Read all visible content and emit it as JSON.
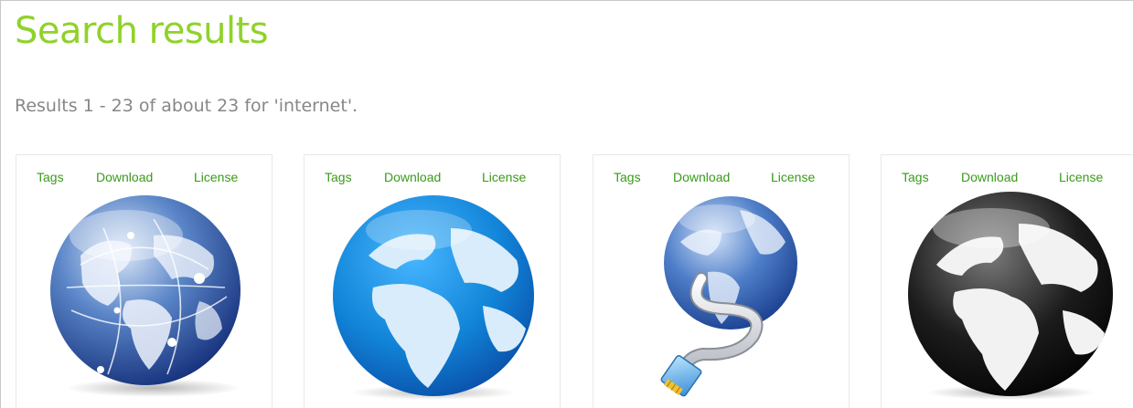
{
  "heading": "Search results",
  "summary": "Results 1 - 23 of about 23 for 'internet'.",
  "colors": {
    "heading": "#8fd22a",
    "summary": "#878787",
    "link": "#3a9a1a"
  },
  "results": [
    {
      "icon": "globe-network-icon",
      "tags_label": "Tags",
      "download_label": "Download",
      "license_label": "License"
    },
    {
      "icon": "globe-blue-icon",
      "tags_label": "Tags",
      "download_label": "Download",
      "license_label": "License"
    },
    {
      "icon": "globe-network-cable-icon",
      "tags_label": "Tags",
      "download_label": "Download",
      "license_label": "License"
    },
    {
      "icon": "globe-black-icon",
      "tags_label": "Tags",
      "download_label": "Download",
      "license_label": "License"
    }
  ]
}
